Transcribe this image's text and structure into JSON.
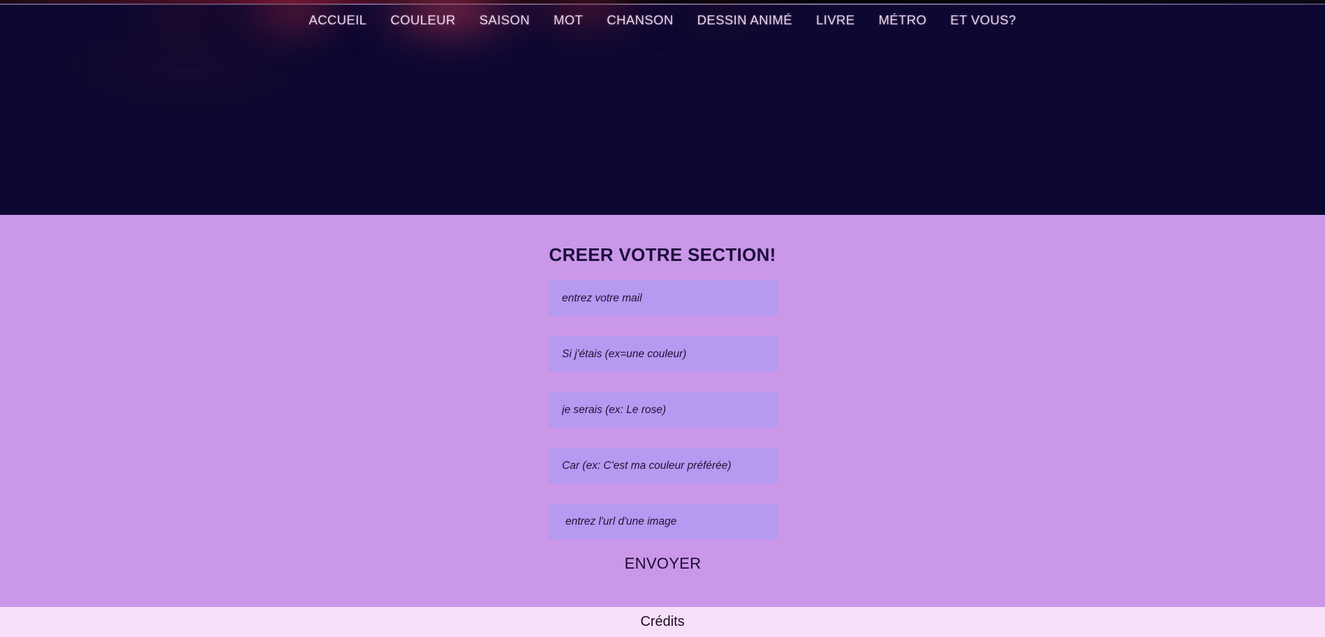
{
  "colors": {
    "hero_bg": "#0d0832",
    "section_bg": "#ca97e9",
    "field_bg": "#b49af1",
    "footer_bg": "#f8e0fa",
    "nav_text": "#ecd3ea",
    "heading_text": "#1d0d3c",
    "glow_accent": "#a83454"
  },
  "nav": {
    "items": [
      {
        "label": "ACCUEIL"
      },
      {
        "label": "COULEUR"
      },
      {
        "label": "SAISON"
      },
      {
        "label": "MOT"
      },
      {
        "label": "CHANSON"
      },
      {
        "label": "DESSIN ANIMÉ"
      },
      {
        "label": "LIVRE"
      },
      {
        "label": "MÉTRO"
      },
      {
        "label": "ET VOUS?"
      }
    ]
  },
  "section": {
    "title": "CREER VOTRE SECTION!",
    "fields": [
      {
        "placeholder": "entrez votre mail",
        "value": ""
      },
      {
        "placeholder": "Si j'étais (ex=une couleur)",
        "value": ""
      },
      {
        "placeholder": "je serais (ex: Le rose)",
        "value": ""
      },
      {
        "placeholder": "Car (ex: C'est ma couleur préférée)",
        "value": ""
      },
      {
        "placeholder": "entrez l'url d'une image",
        "value": ""
      }
    ],
    "submit_label": "ENVOYER"
  },
  "footer": {
    "link_label": "Crédits"
  }
}
